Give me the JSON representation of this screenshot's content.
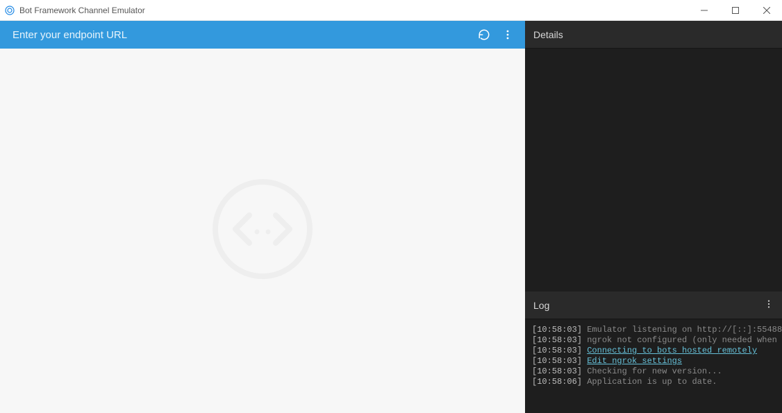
{
  "window": {
    "title": "Bot Framework Channel Emulator"
  },
  "toolbar": {
    "url_placeholder": "Enter your endpoint URL",
    "url_value": ""
  },
  "panels": {
    "details_title": "Details",
    "log_title": "Log"
  },
  "log": [
    {
      "timestamp": "[10:58:03]",
      "text": "Emulator listening on http://[::]:55488",
      "link": false
    },
    {
      "timestamp": "[10:58:03]",
      "text": "ngrok not configured (only needed when connecting to remotely hosted bots)",
      "link": false
    },
    {
      "timestamp": "[10:58:03]",
      "text": "Connecting to bots hosted remotely",
      "link": true
    },
    {
      "timestamp": "[10:58:03]",
      "text": "Edit ngrok settings",
      "link": true
    },
    {
      "timestamp": "[10:58:03]",
      "text": "Checking for new version...",
      "link": false
    },
    {
      "timestamp": "[10:58:06]",
      "text": "Application is up to date.",
      "link": false
    }
  ]
}
